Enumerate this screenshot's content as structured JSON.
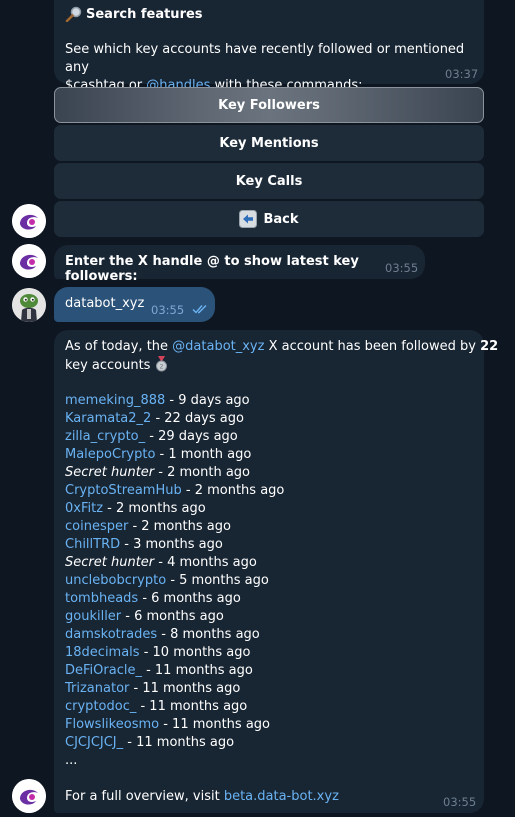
{
  "search_message": {
    "icon": "magnifier-icon",
    "title": "Search features",
    "text_pre": "See which key accounts have recently followed or mentioned any",
    "text_line2_pre": "$cashtag or ",
    "handles_link": "@handles",
    "text_line2_post": " with these commands:",
    "time": "03:37"
  },
  "keyboard": {
    "buttons": [
      {
        "label": "Key Followers"
      },
      {
        "label": "Key Mentions"
      },
      {
        "label": "Key Calls"
      },
      {
        "label": "Back",
        "icon": "back-arrow-icon"
      }
    ]
  },
  "prompt_message": {
    "text": "Enter the X handle @ to show latest key followers:",
    "time": "03:55"
  },
  "user_message": {
    "text": "databot_xyz",
    "time": "03:55",
    "status_icon": "double-check-icon"
  },
  "result_message": {
    "intro_pre": "As of today, the ",
    "handle_link": "@databot_xyz",
    "intro_mid": " X account has been followed by ",
    "count": "22",
    "intro_line2": "key accounts",
    "medal_icon": "medal-icon",
    "followers": [
      {
        "name": "memeking_888",
        "ago": " - 9 days ago",
        "link": true
      },
      {
        "name": "Karamata2_2",
        "ago": " - 22 days ago",
        "link": true
      },
      {
        "name": "zilla_crypto_",
        "ago": " - 29 days ago",
        "link": true
      },
      {
        "name": "MalepoCrypto",
        "ago": " - 1 month ago",
        "link": true
      },
      {
        "name": "Secret hunter",
        "ago": " - 2 month ago",
        "link": false
      },
      {
        "name": "CryptoStreamHub",
        "ago": " - 2 months ago",
        "link": true
      },
      {
        "name": "0xFitz",
        "ago": " - 2 months ago",
        "link": true
      },
      {
        "name": "coinesper",
        "ago": " - 2 months ago",
        "link": true
      },
      {
        "name": "ChillTRD",
        "ago": " - 3 months ago",
        "link": true
      },
      {
        "name": "Secret hunter",
        "ago": " - 4 months ago",
        "link": false
      },
      {
        "name": "unclebobcrypto",
        "ago": " - 5 months ago",
        "link": true
      },
      {
        "name": "tombheads",
        "ago": " - 6 months ago",
        "link": true
      },
      {
        "name": "goukiller",
        "ago": " - 6 months ago",
        "link": true
      },
      {
        "name": "damskotrades",
        "ago": " - 8 months ago",
        "link": true
      },
      {
        "name": "18decimals",
        "ago": " - 10 months ago",
        "link": true
      },
      {
        "name": "DeFiOracle_",
        "ago": " - 11 months ago",
        "link": true
      },
      {
        "name": "Trizanator",
        "ago": " - 11 months ago",
        "link": true
      },
      {
        "name": "cryptodoc_",
        "ago": " - 11 months ago",
        "link": true
      },
      {
        "name": "Flowslikeosmo",
        "ago": " - 11 months ago",
        "link": true
      },
      {
        "name": "CJCJCJCJ_",
        "ago": " - 11 months ago",
        "link": true
      }
    ],
    "ellipsis": "...",
    "overview_pre": "For a full overview, visit ",
    "overview_link": "beta.data-bot.xyz",
    "time": "03:55"
  },
  "colors": {
    "background": "#0e1621",
    "bubble_incoming": "#182533",
    "bubble_outgoing": "#2b5278",
    "link": "#6ab3f3",
    "timestamp": "#6d7f8f"
  }
}
